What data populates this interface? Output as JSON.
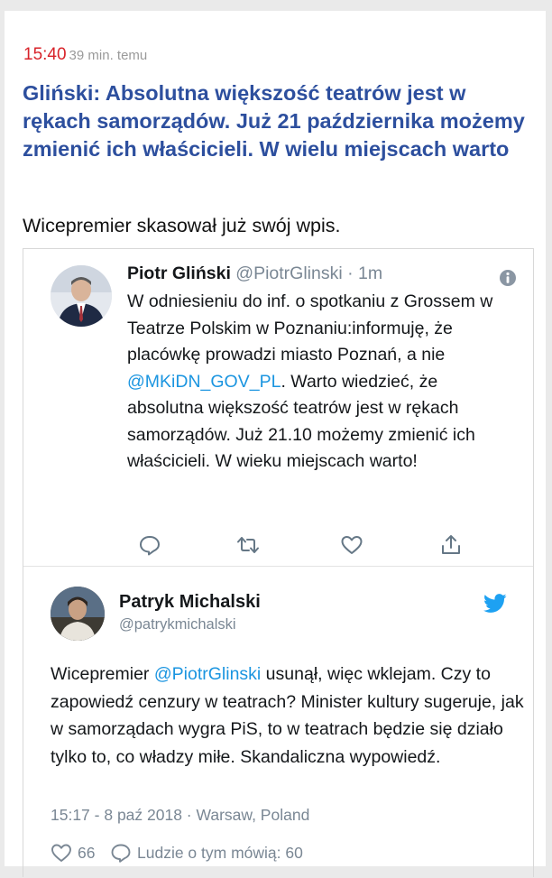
{
  "article": {
    "time": "15:40",
    "ago": "39 min. temu",
    "headline": "Gliński: Absolutna większość teatrów jest w rękach samorządów. Już 21 października możemy zmienić ich właścicieli. W wielu miejscach warto",
    "lead": "Wicepremier skasował już swój wpis."
  },
  "quoted_tweet": {
    "name": "Piotr Gliński",
    "handle": "@PiotrGlinski",
    "age": " · 1m",
    "text_before_mention": "W odniesieniu do inf. o spotkaniu z Grossem w Teatrze Polskim w Poznaniu:informuję, że placówkę prowadzi miasto Poznań, a nie ",
    "mention": "@MKiDN_GOV_PL",
    "text_after_mention": ". Warto wiedzieć, że absolutna większość teatrów jest w rękach samorządów. Już 21.10 możemy zmienić ich właścicieli. W wieku miejscach warto!",
    "actions": [
      "reply-icon",
      "retweet-icon",
      "like-icon",
      "share-icon"
    ]
  },
  "tweet": {
    "name": "Patryk Michalski",
    "handle": "@patrykmichalski",
    "text_before_mention": "Wicepremier ",
    "mention": "@PiotrGlinski",
    "text_after_mention": " usunął, więc wklejam. Czy to zapowiedź cenzury w teatrach? Minister kultury sugeruje, jak w samorządach wygra PiS, to w teatrach będzie się działo tylko to, co władzy miłe. Skandaliczna wypowiedź.",
    "timestamp": "15:17 - 8 paź 2018 · Warsaw, Poland",
    "likes": "66",
    "talking": "Ludzie o tym mówią: 60"
  },
  "colors": {
    "time": "#d8232a",
    "headline": "#2d4f9e",
    "link": "#1b95e0",
    "muted": "#7a8794",
    "twitter_blue": "#1da1f2"
  }
}
